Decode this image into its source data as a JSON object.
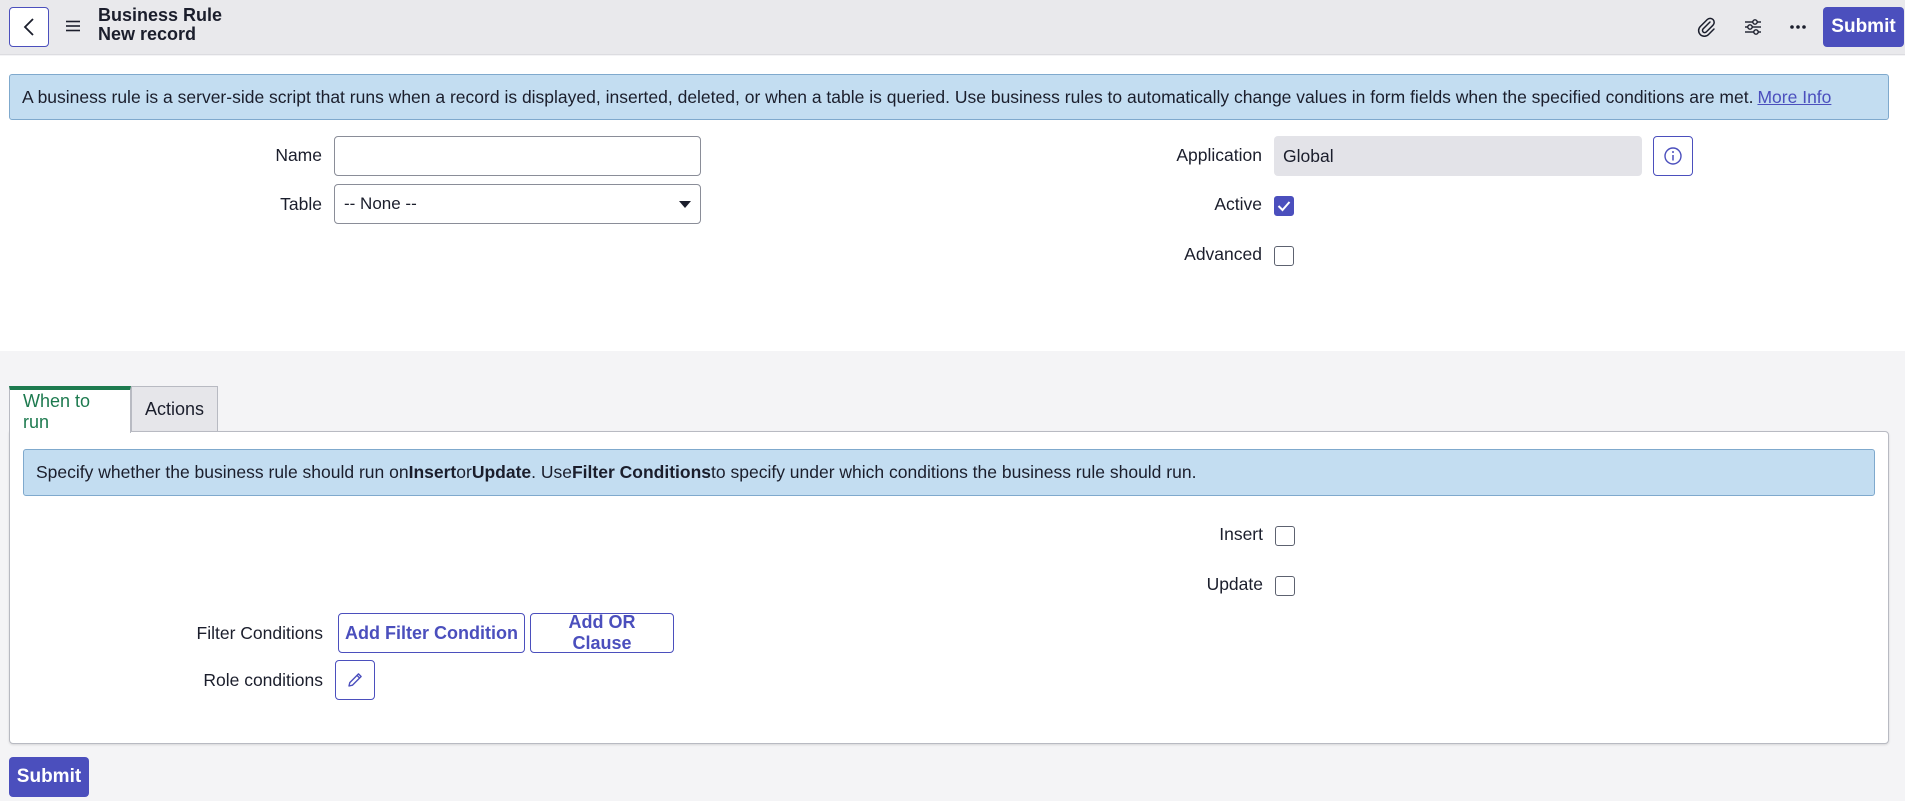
{
  "header": {
    "title": "Business Rule",
    "subtitle": "New record",
    "submit_label": "Submit",
    "icons": [
      "back-icon",
      "menu-icon",
      "paperclip-icon",
      "settings-sliders-icon",
      "more-icon"
    ]
  },
  "info_banner": {
    "text": "A business rule is a server-side script that runs when a record is displayed, inserted, deleted, or when a table is queried. Use business rules to automatically change values in form fields when the specified conditions are met.",
    "link": "More Info"
  },
  "form": {
    "name_label": "Name",
    "name_value": "",
    "table_label": "Table",
    "table_value": "-- None --",
    "application_label": "Application",
    "application_value": "Global",
    "active_label": "Active",
    "active_checked": true,
    "advanced_label": "Advanced",
    "advanced_checked": false
  },
  "tabs": [
    {
      "label": "When to run",
      "active": true
    },
    {
      "label": "Actions",
      "active": false
    }
  ],
  "when_to_run": {
    "banner_parts": {
      "p1": "Specify whether the business rule should run on ",
      "b1": "Insert",
      "p2": " or ",
      "b2": "Update",
      "p3": ". Use ",
      "b3": "Filter Conditions",
      "p4": " to specify under which conditions the business rule should run."
    },
    "insert_label": "Insert",
    "insert_checked": false,
    "update_label": "Update",
    "update_checked": false,
    "filter_conditions_label": "Filter Conditions",
    "add_filter_label": "Add Filter Condition",
    "add_or_label": "Add OR Clause",
    "role_conditions_label": "Role conditions"
  },
  "footer": {
    "submit_label": "Submit"
  },
  "colors": {
    "accent": "#4b4fbd",
    "active_tab": "#1d7a4f",
    "banner_bg": "#c3ddf1"
  }
}
